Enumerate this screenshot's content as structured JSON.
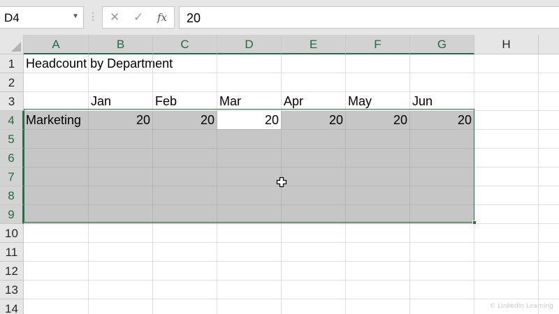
{
  "formula_bar": {
    "name_box": "D4",
    "formula_value": "20"
  },
  "columns": [
    "A",
    "B",
    "C",
    "D",
    "E",
    "F",
    "G",
    "H"
  ],
  "rows": [
    "1",
    "2",
    "3",
    "4",
    "5",
    "6",
    "7",
    "8",
    "9",
    "10",
    "11",
    "12",
    "13",
    "14"
  ],
  "cells": {
    "A1": "Headcount by Department",
    "B3": "Jan",
    "C3": "Feb",
    "D3": "Mar",
    "E3": "Apr",
    "F3": "May",
    "G3": "Jun",
    "A4": "Marketing",
    "B4": "20",
    "C4": "20",
    "D4": "20",
    "E4": "20",
    "F4": "20",
    "G4": "20"
  },
  "selection": {
    "range": "A4:G9",
    "active_cell": "D4"
  },
  "colors": {
    "accent": "#217346",
    "selection_fill": "#c6c6c6"
  },
  "icons": {
    "cancel": "close-icon",
    "enter": "check-icon",
    "function": "fx-icon",
    "cursor": "plus-cross-cursor-icon"
  },
  "watermark": "© LinkedIn Learning"
}
